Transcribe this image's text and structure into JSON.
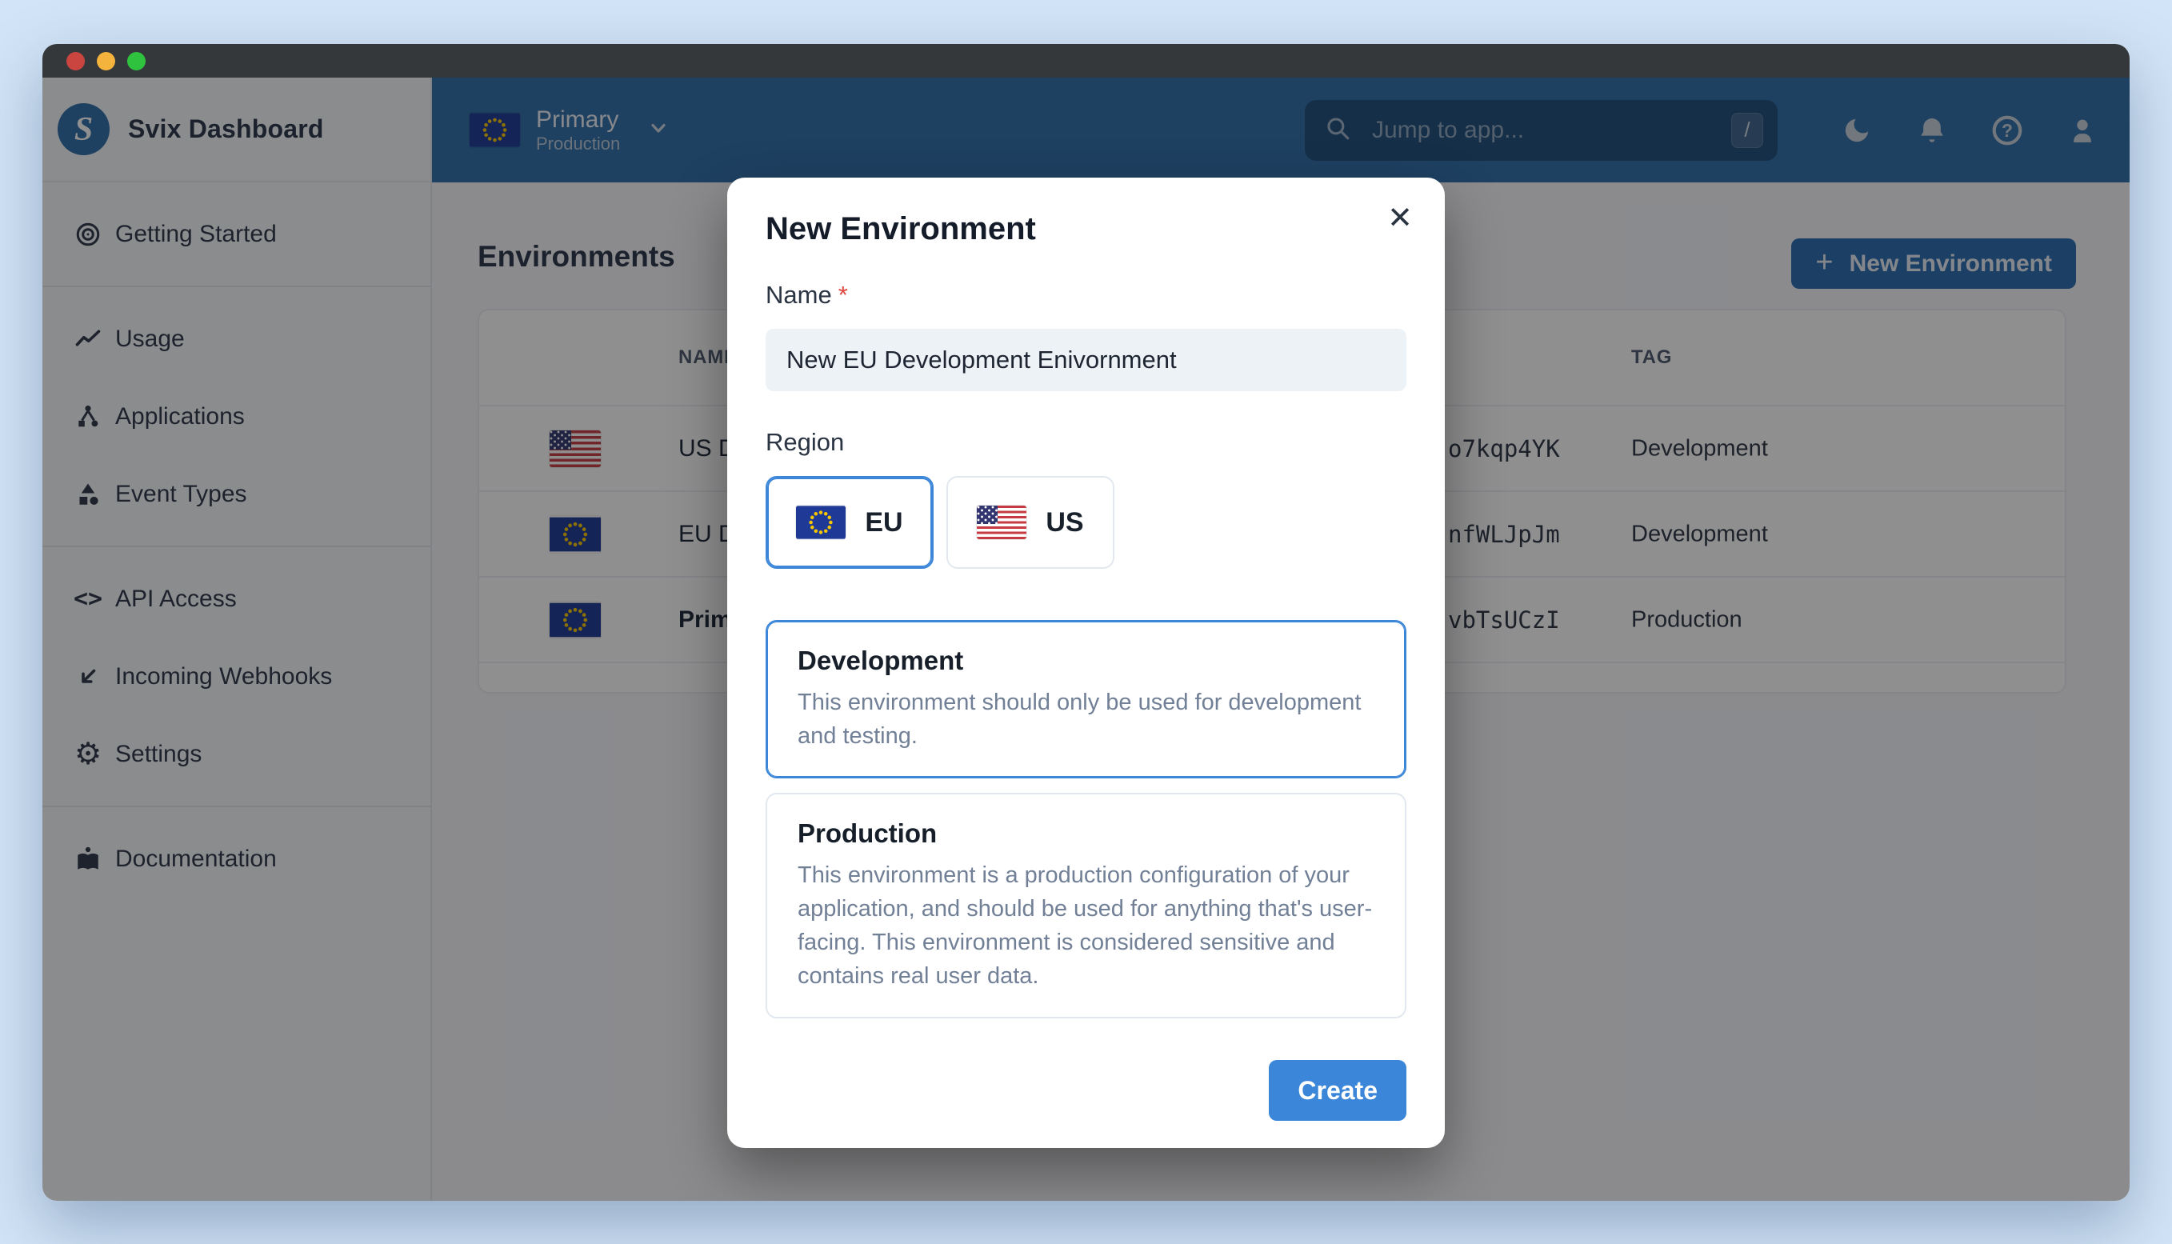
{
  "icons": {
    "logo_s": "S",
    "plus": "+",
    "close": "✕",
    "code_glyph": "<>",
    "gear_glyph": "⚙",
    "question": "?"
  },
  "sidebar": {
    "brand": "Svix Dashboard",
    "items": [
      {
        "label": "Getting Started",
        "icon": "target-icon"
      },
      {
        "label": "Usage",
        "icon": "trend-line-icon"
      },
      {
        "label": "Applications",
        "icon": "nodes-icon"
      },
      {
        "label": "Event Types",
        "icon": "shapes-icon"
      },
      {
        "label": "API Access",
        "icon": "code-icon"
      },
      {
        "label": "Incoming Webhooks",
        "icon": "arrow-down-left-icon"
      },
      {
        "label": "Settings",
        "icon": "gear-icon"
      },
      {
        "label": "Documentation",
        "icon": "book-icon"
      }
    ]
  },
  "topbar": {
    "environment": {
      "name": "Primary",
      "tag": "Production",
      "flag": "eu"
    },
    "search": {
      "placeholder": "Jump to app...",
      "shortcut": "/"
    }
  },
  "content": {
    "heading": "Environments",
    "new_environment_button": "New Environment",
    "table": {
      "columns": {
        "name": "NAME",
        "tag": "TAG"
      },
      "rows": [
        {
          "flag": "us",
          "name": "US Development",
          "id_fragment": "o7kqp4YK",
          "tag": "Development",
          "bold": false
        },
        {
          "flag": "eu",
          "name": "EU Development",
          "id_fragment": "nfWLJpJm",
          "tag": "Development",
          "bold": false
        },
        {
          "flag": "eu",
          "name": "Primary",
          "id_fragment": "vbTsUCzI",
          "tag": "Production",
          "bold": true
        }
      ]
    }
  },
  "modal": {
    "title": "New Environment",
    "name_label": "Name",
    "required_mark": "*",
    "name_value": "New EU Development Enivornment",
    "region_label": "Region",
    "regions": [
      {
        "label": "EU",
        "flag": "eu",
        "selected": true
      },
      {
        "label": "US",
        "flag": "us",
        "selected": false
      }
    ],
    "environment_types": [
      {
        "title": "Development",
        "selected": true,
        "description": "This environment should only be used for development and testing."
      },
      {
        "title": "Production",
        "selected": false,
        "description": "This environment is a production configuration of your application, and should be used for anything that's user-facing. This environment is considered sensitive and contains real user data."
      }
    ],
    "create_button": "Create"
  },
  "colors": {
    "topbar_blue": "#2f6ea9",
    "primary_button_blue": "#2b6cb0",
    "accent_blue": "#3b86d8",
    "input_bg": "#edf2f7",
    "overlay": "rgba(10,11,14,0.46)"
  }
}
